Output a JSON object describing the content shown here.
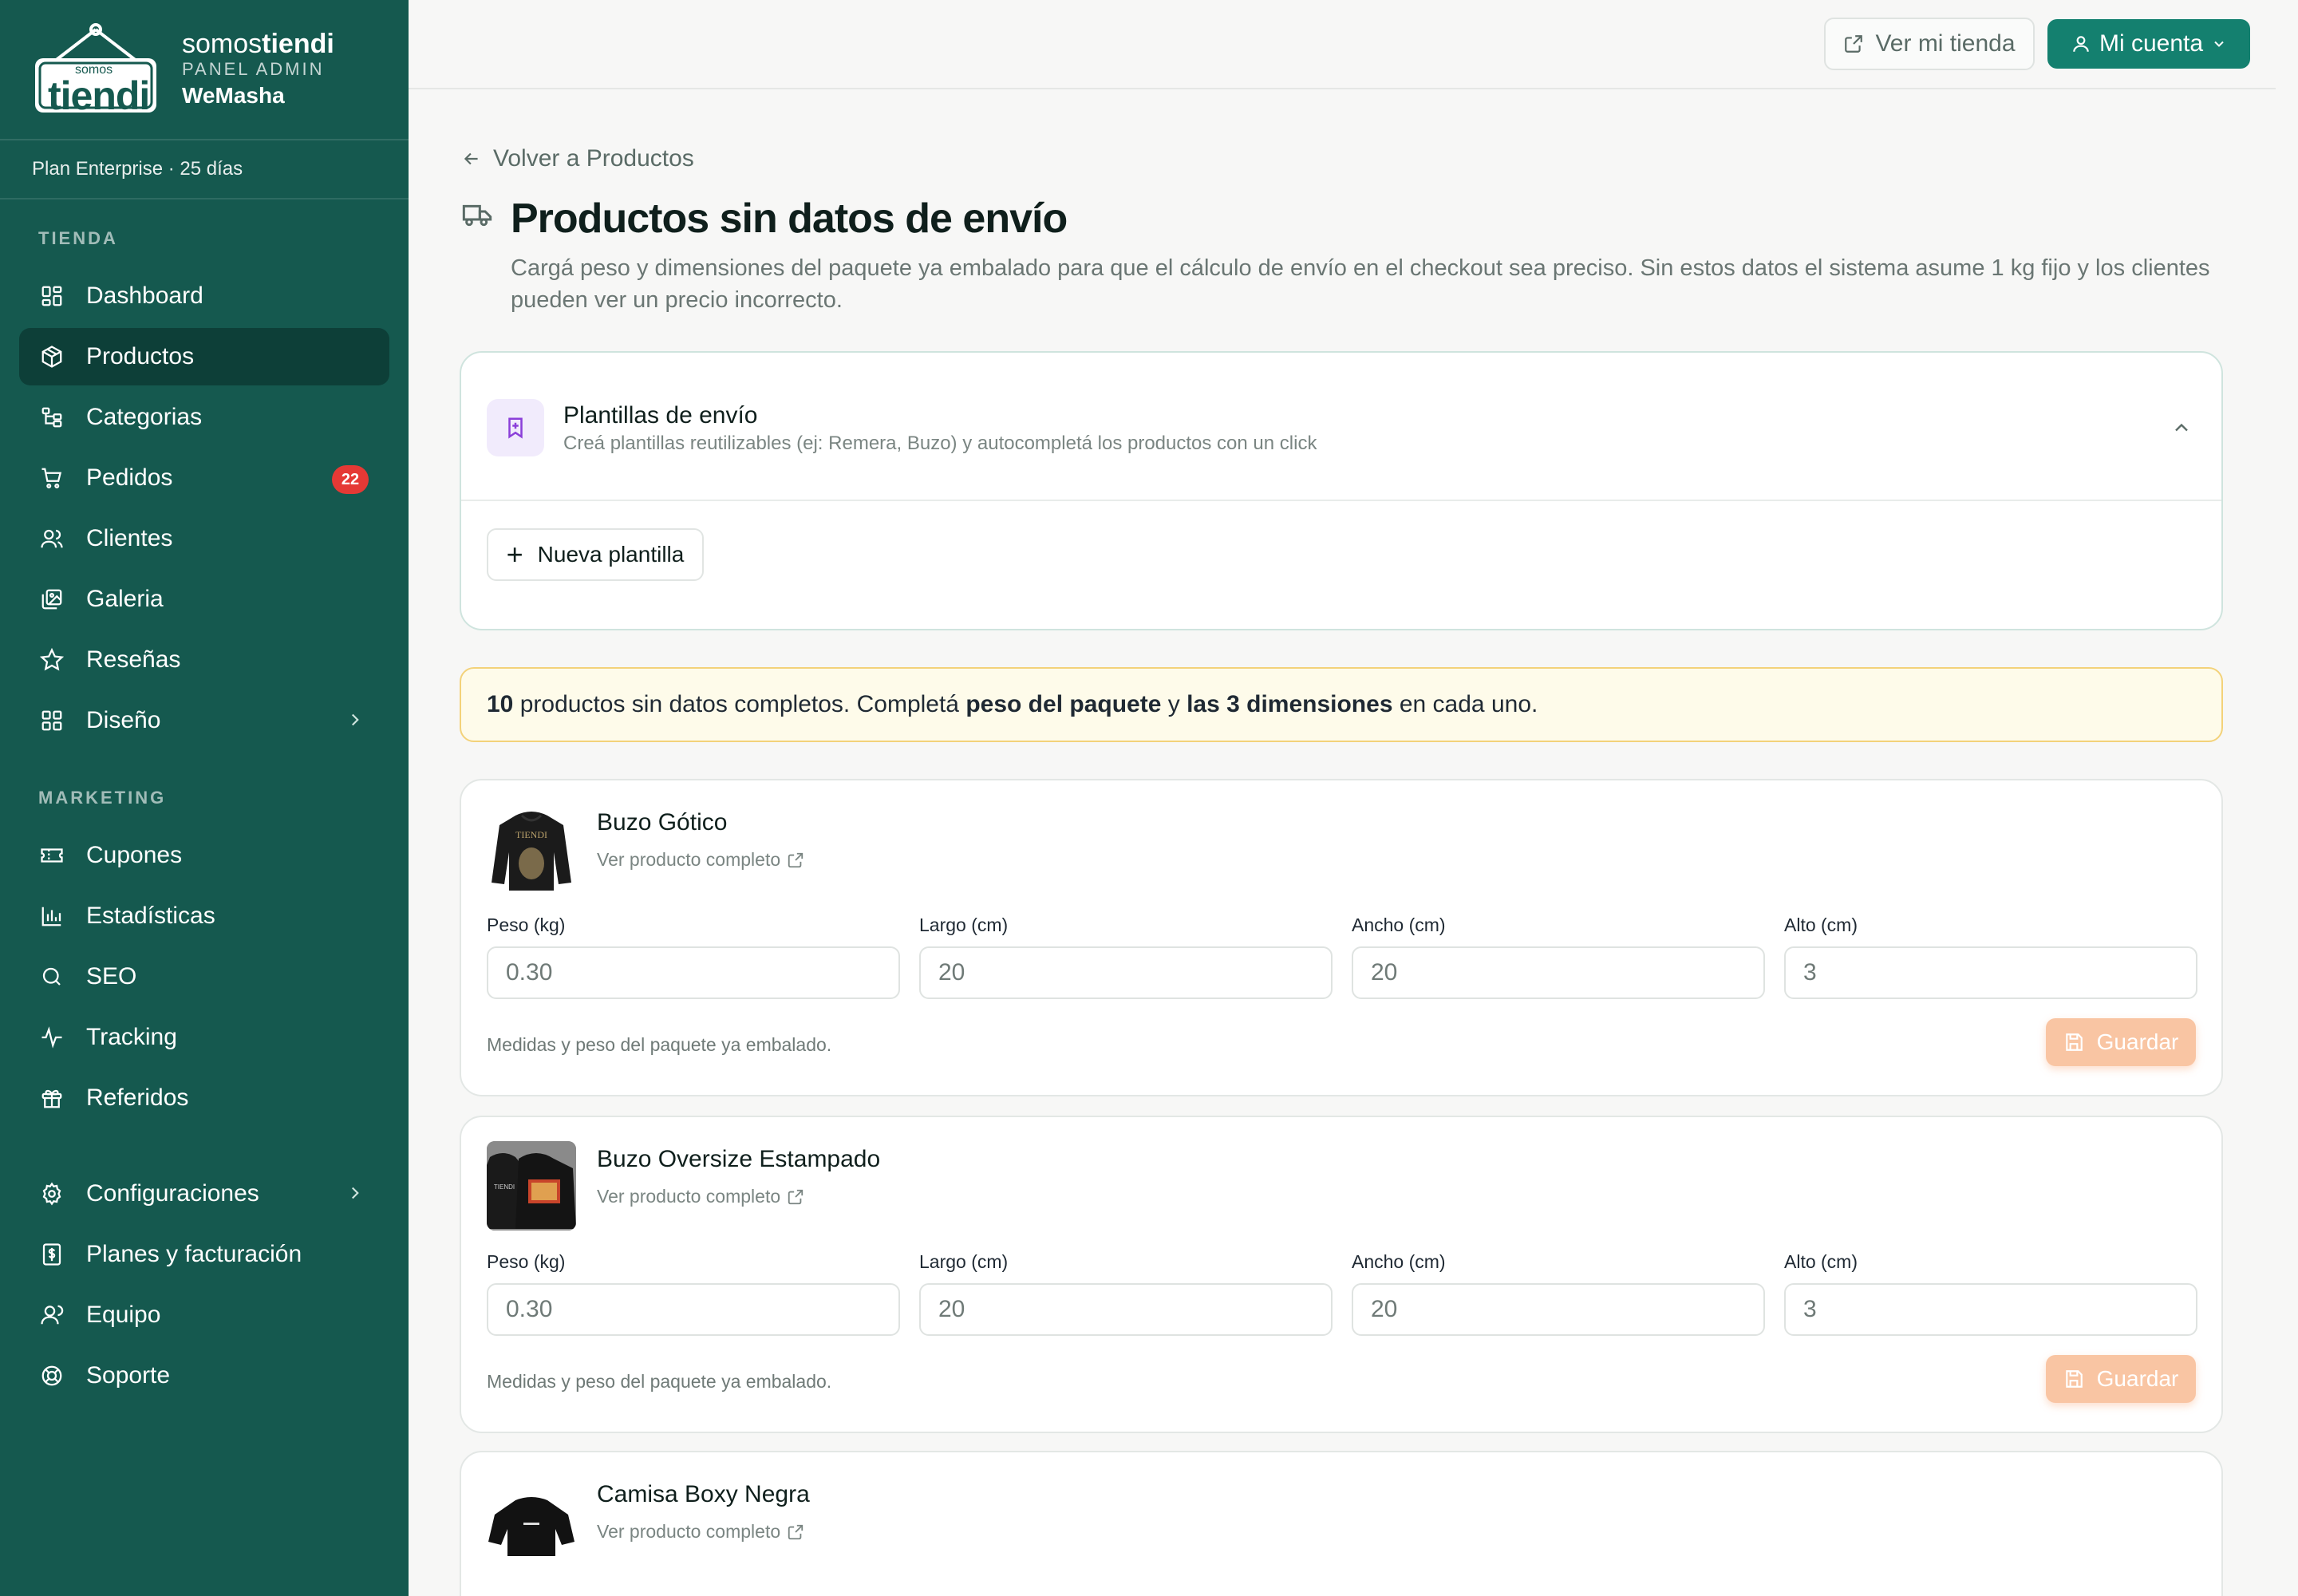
{
  "brand": {
    "logo_small": "somos",
    "logo_big": "tiendi",
    "name_light": "somos",
    "name_bold": "tiendi",
    "panel_label": "PANEL ADMIN",
    "store_name": "WeMasha"
  },
  "plan": "Plan Enterprise · 25 días",
  "sidebar": {
    "section_store": "TIENDA",
    "section_marketing": "MARKETING",
    "items": [
      {
        "label": "Dashboard",
        "icon": "grid-icon"
      },
      {
        "label": "Productos",
        "icon": "box-icon",
        "active": true
      },
      {
        "label": "Categorias",
        "icon": "tree-icon"
      },
      {
        "label": "Pedidos",
        "icon": "cart-icon",
        "badge": "22"
      },
      {
        "label": "Clientes",
        "icon": "users-icon"
      },
      {
        "label": "Galeria",
        "icon": "gallery-icon"
      },
      {
        "label": "Reseñas",
        "icon": "star-icon"
      },
      {
        "label": "Diseño",
        "icon": "layout-icon"
      },
      {
        "label": "Cupones",
        "icon": "ticket-icon"
      },
      {
        "label": "Estadísticas",
        "icon": "bar-chart-icon"
      },
      {
        "label": "SEO",
        "icon": "search-icon"
      },
      {
        "label": "Tracking",
        "icon": "activity-icon"
      },
      {
        "label": "Referidos",
        "icon": "gift-icon"
      },
      {
        "label": "Configuraciones",
        "icon": "gear-icon"
      },
      {
        "label": "Planes y facturación",
        "icon": "receipt-icon"
      },
      {
        "label": "Equipo",
        "icon": "user-icon"
      },
      {
        "label": "Soporte",
        "icon": "lifebuoy-icon"
      }
    ]
  },
  "topbar": {
    "view_store": "Ver mi tienda",
    "account": "Mi cuenta"
  },
  "page": {
    "back": "Volver a Productos",
    "title": "Productos sin datos de envío",
    "subtitle": "Cargá peso y dimensiones del paquete ya embalado para que el cálculo de envío en el checkout sea preciso. Sin estos datos el sistema asume 1 kg fijo y los clientes pueden ver un precio incorrecto."
  },
  "templates": {
    "title": "Plantillas de envío",
    "description": "Creá plantillas reutilizables (ej: Remera, Buzo) y autocompletá los productos con un click",
    "new_button": "Nueva plantilla"
  },
  "notice": {
    "count": "10",
    "text1": " productos sin datos completos. Completá ",
    "bold1": "peso del paquete",
    "text2": " y ",
    "bold2": "las 3 dimensiones",
    "text3": " en cada uno."
  },
  "field_labels": {
    "weight": "Peso (kg)",
    "length": "Largo (cm)",
    "width": "Ancho (cm)",
    "height": "Alto (cm)"
  },
  "products": [
    {
      "name": "Buzo Gótico",
      "link": "Ver producto completo",
      "weight": "0.30",
      "length": "20",
      "width": "20",
      "height": "3",
      "hint": "Medidas y peso del paquete ya embalado.",
      "save": "Guardar"
    },
    {
      "name": "Buzo Oversize Estampado",
      "link": "Ver producto completo",
      "weight": "0.30",
      "length": "20",
      "width": "20",
      "height": "3",
      "hint": "Medidas y peso del paquete ya embalado.",
      "save": "Guardar"
    },
    {
      "name": "Camisa Boxy Negra",
      "link": "Ver producto completo"
    }
  ],
  "colors": {
    "sidebar": "#15594f",
    "active_item": "#0d3f38",
    "accent": "#14806f",
    "badge": "#e53935",
    "save_button": "#f9c5a3",
    "notice_bg": "#fefbea"
  }
}
